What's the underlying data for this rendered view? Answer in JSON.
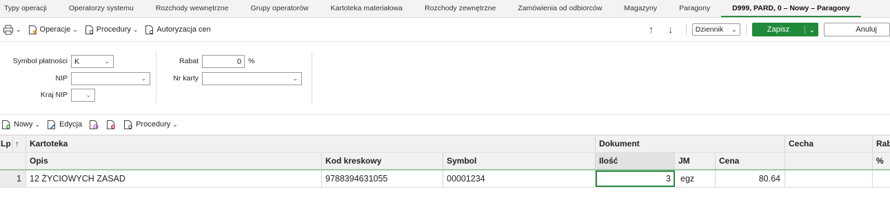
{
  "tabs": [
    "Typy operacji",
    "Operatorzy systemu",
    "Rozchody wewnętrzne",
    "Grupy operatorów",
    "Kartoteka materiałowa",
    "Rozchody zewnętrzne",
    "Zamówienia od odbiorców",
    "Magazyny",
    "Paragony",
    "D999, PARD, 0 – Nowy – Paragony"
  ],
  "toolbar": {
    "operations": "Operacje",
    "procedures": "Procedury",
    "price_auth": "Autoryzacja cen",
    "journal": "Dziennik",
    "save": "Zapisz",
    "cancel": "Anuluj"
  },
  "form": {
    "payment_label": "Symbol płatności",
    "payment_value": "K",
    "nip_label": "NIP",
    "nip_value": "",
    "country_label": "Kraj NIP",
    "country_value": "",
    "discount_label": "Rabat",
    "discount_value": "0",
    "discount_unit": "%",
    "card_label": "Nr karty",
    "card_value": ""
  },
  "items_toolbar": {
    "new": "Nowy",
    "edit": "Edycja",
    "procedures": "Procedury"
  },
  "grid": {
    "lp": "Lp",
    "sort": "↑",
    "kartoteka": "Kartoteka",
    "dokument": "Dokument",
    "cecha": "Cecha",
    "rab": "Rab",
    "opis": "Opis",
    "kod": "Kod kreskowy",
    "symbol": "Symbol",
    "ilosc": "Ilość",
    "jm": "JM",
    "cena": "Cena",
    "pct": "%",
    "rows": [
      {
        "lp": "1",
        "opis": "12 ŻYCIOWYCH ZASAD",
        "kod": "9788394631055",
        "symbol": "00001234",
        "ilosc": "3",
        "jm": "egz",
        "cena": "80.64"
      }
    ]
  }
}
